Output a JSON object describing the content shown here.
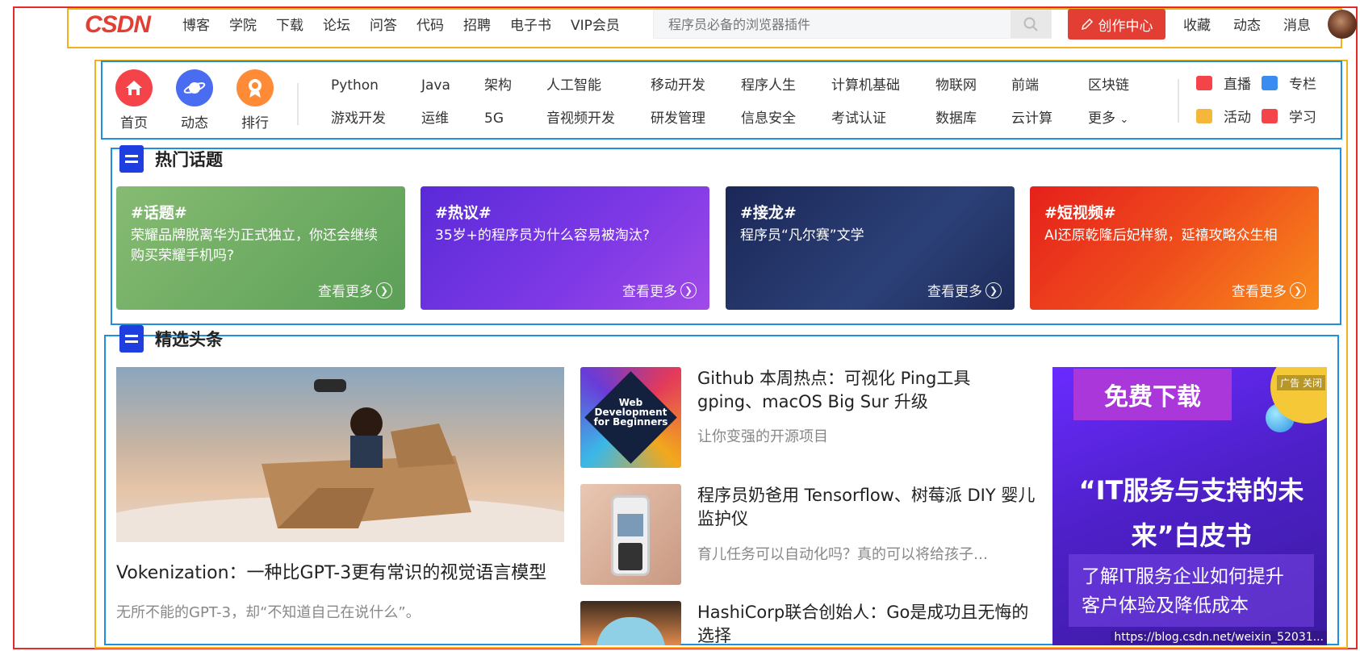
{
  "topbar": {
    "logo": "CSDN",
    "nav": [
      "博客",
      "学院",
      "下载",
      "论坛",
      "问答",
      "代码",
      "招聘",
      "电子书",
      "VIP会员"
    ],
    "search_placeholder": "程序员必备的浏览器插件",
    "create_button": "创作中心",
    "right_links": [
      "收藏",
      "动态",
      "消息"
    ]
  },
  "quick_nav": [
    {
      "label": "首页",
      "icon": "home-icon",
      "color": "#f5434a"
    },
    {
      "label": "动态",
      "icon": "planet-icon",
      "color": "#4a6cf0"
    },
    {
      "label": "排行",
      "icon": "medal-icon",
      "color": "#ff8b36"
    }
  ],
  "categories": [
    "Python",
    "Java",
    "架构",
    "人工智能",
    "移动开发",
    "程序人生",
    "计算机基础",
    "物联网",
    "前端",
    "区块链",
    "游戏开发",
    "运维",
    "5G",
    "音视频开发",
    "研发管理",
    "信息安全",
    "考试认证",
    "数据库",
    "云计算",
    "更多"
  ],
  "right_nav": [
    {
      "label": "直播",
      "icon": "live-icon",
      "color": "#f5434a"
    },
    {
      "label": "专栏",
      "icon": "column-icon",
      "color": "#3b8cf0"
    },
    {
      "label": "活动",
      "icon": "activity-icon",
      "color": "#f5b73b"
    },
    {
      "label": "学习",
      "icon": "learn-icon",
      "color": "#f5434a"
    }
  ],
  "hot_topics": {
    "title": "热门话题",
    "cards": [
      {
        "tag": "#话题#",
        "desc": "荣耀品牌脱离华为正式独立，你还会继续购买荣耀手机吗?",
        "more": "查看更多",
        "bg": "linear-gradient(135deg,#7cb36a,#4d9a4c)"
      },
      {
        "tag": "#热议#",
        "desc": "35岁+的程序员为什么容易被淘汰?",
        "more": "查看更多",
        "bg": "linear-gradient(135deg,#6a2ee0,#8a3be6)"
      },
      {
        "tag": "#接龙#",
        "desc": "程序员“凡尔赛”文学",
        "more": "查看更多",
        "bg": "linear-gradient(135deg,#1d2b5a,#2f4680)"
      },
      {
        "tag": "#短视频#",
        "desc": "AI还原乾隆后妃样貌，延禧攻略众生相",
        "more": "查看更多",
        "bg": "linear-gradient(135deg,#e9281d,#f7891a)"
      }
    ]
  },
  "featured": {
    "title": "精选头条",
    "hero": {
      "title": "Vokenization：一种比GPT-3更有常识的视觉语言模型",
      "subtitle": "无所不能的GPT-3，却“不知道自己在说什么”。"
    },
    "items": [
      {
        "title": "Github 本周热点：可视化 Ping工具 gping、macOS Big Sur 升级",
        "subtitle": "让你变强的开源项目",
        "thumb_text": "Web Development for Beginners"
      },
      {
        "title": "程序员奶爸用 Tensorflow、树莓派 DIY 婴儿监护仪",
        "subtitle": "育儿任务可以自动化吗？真的可以将给孩子…",
        "thumb_text": ""
      },
      {
        "title": "HashiCorp联合创始人：Go是成功且无悔的选择",
        "subtitle": "",
        "thumb_text": ""
      }
    ]
  },
  "ad": {
    "headline": "免费下载",
    "badge": "广告 关闭",
    "big_text": "“IT服务与支持的未来”白皮书",
    "sub_text": "了解IT服务企业如何提升客户体验及降低成本",
    "url": "https://blog.csdn.net/weixin_52031..."
  }
}
